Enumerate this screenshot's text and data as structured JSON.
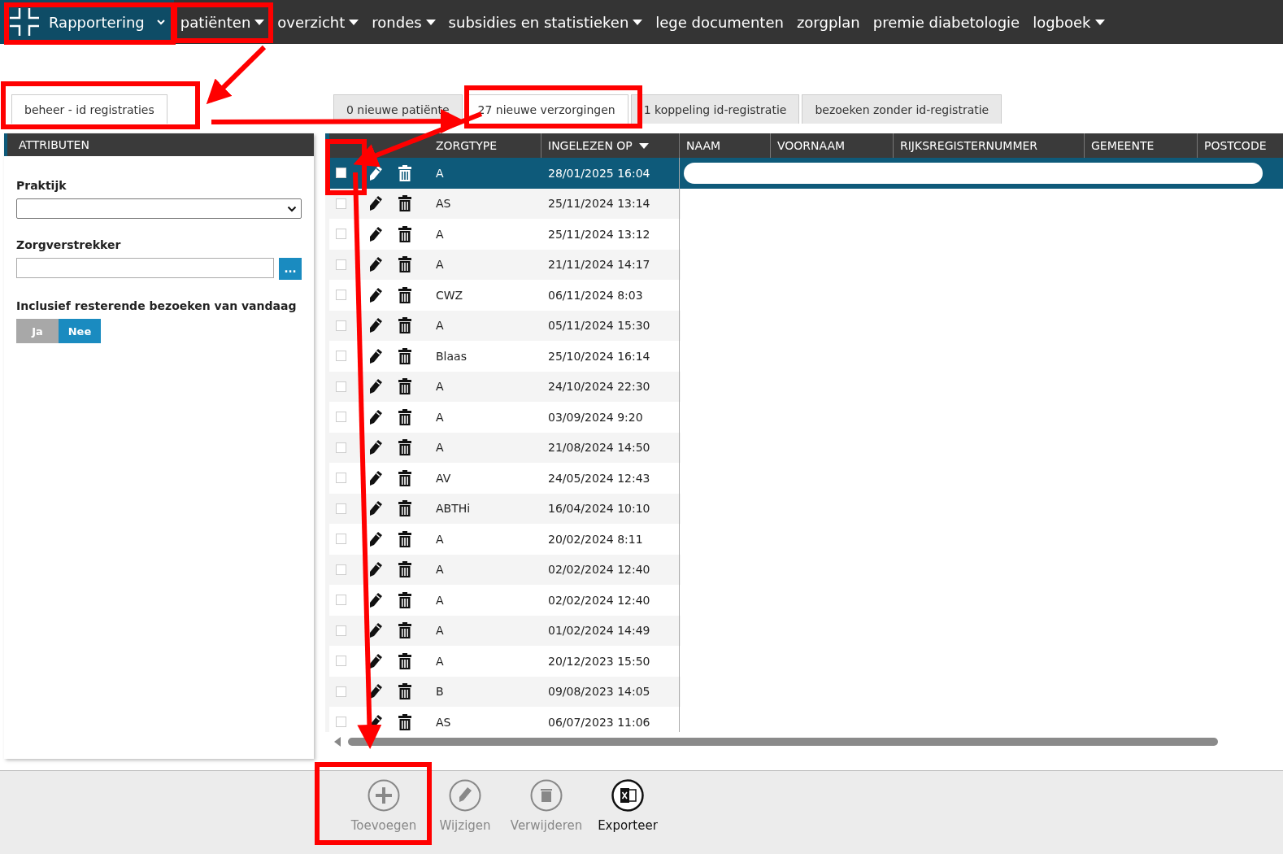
{
  "nav": {
    "brand": {
      "label": "Rapportering",
      "selected": true
    },
    "items": [
      {
        "label": "patiënten",
        "caret": true
      },
      {
        "label": "overzicht",
        "caret": true
      },
      {
        "label": "rondes",
        "caret": true
      },
      {
        "label": "subsidies en statistieken",
        "caret": true
      },
      {
        "label": "lege documenten",
        "caret": false
      },
      {
        "label": "zorgplan",
        "caret": false
      },
      {
        "label": "premie diabetologie",
        "caret": false
      },
      {
        "label": "logboek",
        "caret": true
      }
    ]
  },
  "left_tabs": [
    {
      "label": "beheer - id registraties",
      "selected": true
    }
  ],
  "attributes": {
    "title": "ATTRIBUTEN",
    "fields": [
      {
        "kind": "select",
        "label": "Praktijk"
      },
      {
        "kind": "lookup",
        "label": "Zorgverstrekker",
        "button": "..."
      }
    ],
    "toggle": {
      "label": "Inclusief resterende bezoeken van vandaag",
      "options": [
        {
          "label": "Ja",
          "selected": false
        },
        {
          "label": "Nee",
          "selected": true
        }
      ]
    }
  },
  "tabs": [
    {
      "label": "0 nieuwe patiënte",
      "selected": false
    },
    {
      "label": "27 nieuwe verzorgingen",
      "selected": true
    },
    {
      "label": "1 koppeling id-registratie",
      "selected": false
    },
    {
      "label": "bezoeken zonder id-registratie",
      "selected": false
    }
  ],
  "table": {
    "columns": [
      {
        "label": "ZORGTYPE",
        "sorted": false
      },
      {
        "label": "INGELEZEN OP",
        "sorted": true
      },
      {
        "label": "NAAM",
        "sorted": false
      },
      {
        "label": "VOORNAAM",
        "sorted": false
      },
      {
        "label": "RIJKSREGISTERNUMMER",
        "sorted": false
      },
      {
        "label": "GEMEENTE",
        "sorted": false
      },
      {
        "label": "POSTCODE",
        "sorted": false
      }
    ],
    "rows": [
      {
        "selected": true,
        "checked": false,
        "zorgtype": "A",
        "ingelezen_op": "28/01/2025 16:04"
      },
      {
        "selected": false,
        "checked": false,
        "zorgtype": "AS",
        "ingelezen_op": "25/11/2024 13:14"
      },
      {
        "selected": false,
        "checked": false,
        "zorgtype": "A",
        "ingelezen_op": "25/11/2024 13:12"
      },
      {
        "selected": false,
        "checked": false,
        "zorgtype": "A",
        "ingelezen_op": "21/11/2024 14:17"
      },
      {
        "selected": false,
        "checked": false,
        "zorgtype": "CWZ",
        "ingelezen_op": "06/11/2024 8:03"
      },
      {
        "selected": false,
        "checked": false,
        "zorgtype": "A",
        "ingelezen_op": "05/11/2024 15:30"
      },
      {
        "selected": false,
        "checked": false,
        "zorgtype": "Blaas",
        "ingelezen_op": "25/10/2024 16:14"
      },
      {
        "selected": false,
        "checked": false,
        "zorgtype": "A",
        "ingelezen_op": "24/10/2024 22:30"
      },
      {
        "selected": false,
        "checked": false,
        "zorgtype": "A",
        "ingelezen_op": "03/09/2024 9:20"
      },
      {
        "selected": false,
        "checked": false,
        "zorgtype": "A",
        "ingelezen_op": "21/08/2024 14:50"
      },
      {
        "selected": false,
        "checked": false,
        "zorgtype": "AV",
        "ingelezen_op": "24/05/2024 12:43"
      },
      {
        "selected": false,
        "checked": false,
        "zorgtype": "ABTHi",
        "ingelezen_op": "16/04/2024 10:10"
      },
      {
        "selected": false,
        "checked": false,
        "zorgtype": "A",
        "ingelezen_op": "20/02/2024 8:11"
      },
      {
        "selected": false,
        "checked": false,
        "zorgtype": "A",
        "ingelezen_op": "02/02/2024 12:40"
      },
      {
        "selected": false,
        "checked": false,
        "zorgtype": "A",
        "ingelezen_op": "02/02/2024 12:40"
      },
      {
        "selected": false,
        "checked": false,
        "zorgtype": "A",
        "ingelezen_op": "01/02/2024 14:49"
      },
      {
        "selected": false,
        "checked": false,
        "zorgtype": "A",
        "ingelezen_op": "20/12/2023 15:50"
      },
      {
        "selected": false,
        "checked": false,
        "zorgtype": "B",
        "ingelezen_op": "09/08/2023 14:05"
      },
      {
        "selected": false,
        "checked": false,
        "zorgtype": "AS",
        "ingelezen_op": "06/07/2023 11:06"
      }
    ]
  },
  "toolbar": [
    {
      "kind": "add",
      "label": "Toevoegen",
      "disabled": true
    },
    {
      "kind": "edit",
      "label": "Wijzigen",
      "disabled": true
    },
    {
      "kind": "delete",
      "label": "Verwijderen",
      "disabled": true
    },
    {
      "kind": "export",
      "label": "Exporteer",
      "disabled": false
    }
  ]
}
